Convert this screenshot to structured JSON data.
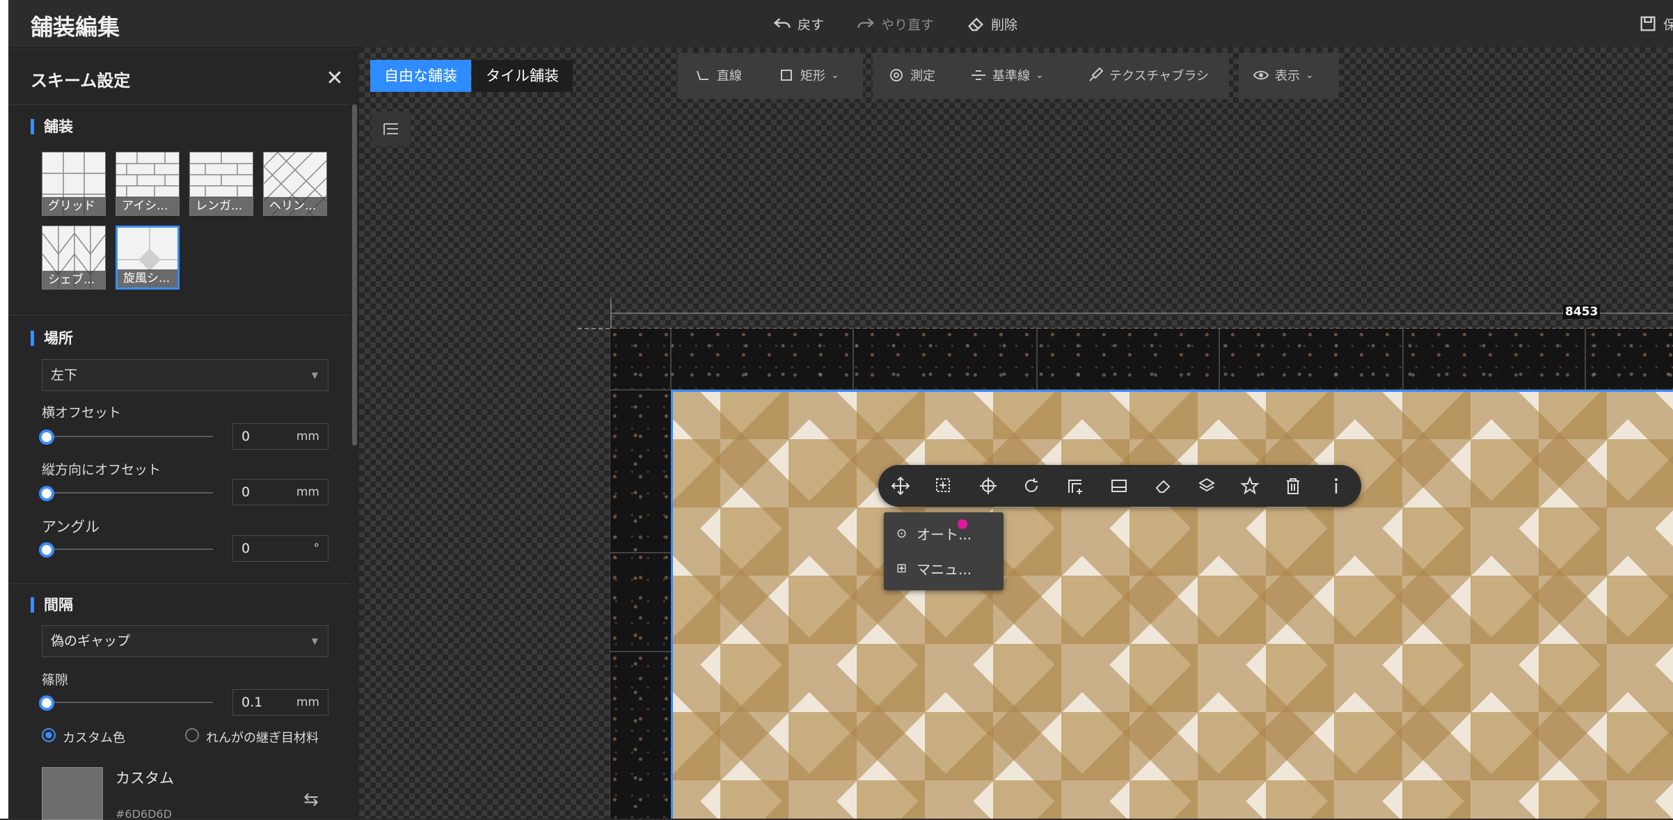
{
  "header": {
    "title": "舗装編集",
    "undo_label": "戻す",
    "redo_label": "やり直す",
    "delete_label": "削除",
    "save_label": "保"
  },
  "panel": {
    "title": "スキーム設定",
    "paving_section": "舗装",
    "tiles": [
      {
        "label": "グリッド"
      },
      {
        "label": "アイシ..."
      },
      {
        "label": "レンガ..."
      },
      {
        "label": "ヘリン..."
      },
      {
        "label": "シェブ..."
      },
      {
        "label": "旋風シ..."
      }
    ],
    "location_section": "場所",
    "location_value": "左下",
    "h_offset_label": "横オフセット",
    "h_offset_value": "0",
    "h_offset_unit": "mm",
    "v_offset_label": "縦方向にオフセット",
    "v_offset_value": "0",
    "v_offset_unit": "mm",
    "angle_label": "アングル",
    "angle_value": "0",
    "angle_unit": "°",
    "gap_section": "間隔",
    "gap_type_value": "偽のギャップ",
    "gap_label": "篠隙",
    "gap_value": "0.1",
    "gap_unit": "mm",
    "radio_custom": "カスタム色",
    "radio_brick": "れんがの継ぎ目材料",
    "custom_label": "カスタム",
    "custom_hex": "#6D6D6D",
    "custom_color": "#6D6D6D"
  },
  "canvas": {
    "mode_free": "自由な舗装",
    "mode_tile": "タイル舗装",
    "tool_line": "直線",
    "tool_rect": "矩形",
    "tool_measure": "測定",
    "tool_baseline": "基準線",
    "tool_texture": "テクスチャブラシ",
    "tool_view": "表示",
    "dimension": "8453",
    "menu_auto": "オート...",
    "menu_manual": "マニュ..."
  },
  "colors": {
    "accent": "#3a8dff"
  }
}
